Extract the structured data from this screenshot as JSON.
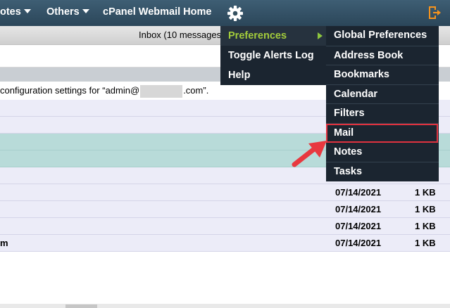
{
  "topbar": {
    "nav_notes": "otes",
    "nav_others": "Others",
    "nav_home": "cPanel Webmail Home",
    "icons": {
      "settings": "gear-icon",
      "logout": "logout-icon"
    }
  },
  "inbox": {
    "title": "Inbox (10 messages"
  },
  "notice": {
    "prefix": "configuration settings for “admin@",
    "suffix": ".com”."
  },
  "messages": [
    {
      "partial": "",
      "date": "07/14/2021",
      "size": "1 KB"
    },
    {
      "partial": "",
      "date": "07/14/2021",
      "size": "1 KB"
    },
    {
      "partial": "",
      "date": "07/14/2021",
      "size": "1 KB"
    },
    {
      "partial": "m",
      "date": "07/14/2021",
      "size": "1 KB"
    }
  ],
  "menu": {
    "items": [
      "Preferences",
      "Toggle Alerts Log",
      "Help"
    ],
    "submenu": [
      "Global Preferences",
      "Address Book",
      "Bookmarks",
      "Calendar",
      "Filters",
      "Mail",
      "Notes",
      "Tasks"
    ]
  },
  "colors": {
    "topbar": "#34505f",
    "menu": "#1b2530",
    "active_menu_text": "#a3cc3b",
    "highlight_border": "#e0323f",
    "annotation_arrow": "#e8383f"
  }
}
